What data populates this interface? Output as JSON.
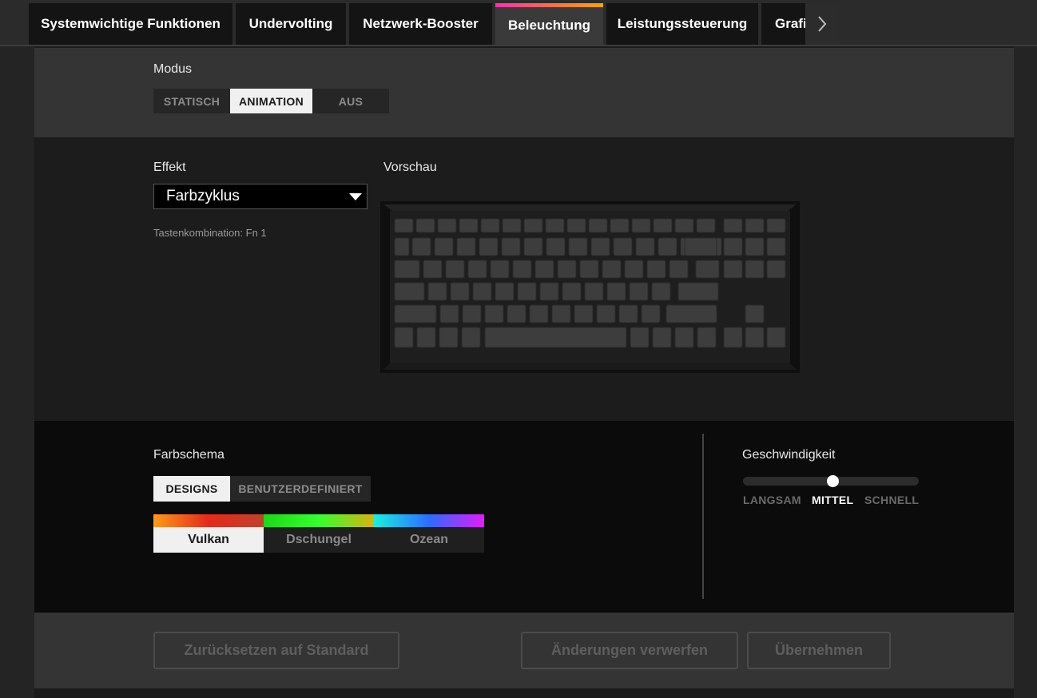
{
  "tabs": [
    {
      "label": "Systemwichtige Funktionen"
    },
    {
      "label": "Undervolting"
    },
    {
      "label": "Netzwerk-Booster"
    },
    {
      "label": "Beleuchtung"
    },
    {
      "label": "Leistungssteuerung"
    },
    {
      "label": "Grafi"
    }
  ],
  "active_tab": "Beleuchtung",
  "mode": {
    "label": "Modus",
    "options": [
      "STATISCH",
      "ANIMATION",
      "AUS"
    ],
    "selected": "ANIMATION"
  },
  "effect": {
    "label": "Effekt",
    "value": "Farbzyklus",
    "hint": "Tastenkombination: Fn 1"
  },
  "preview": {
    "label": "Vorschau"
  },
  "color_scheme": {
    "label": "Farbschema",
    "tabs": [
      "DESIGNS",
      "BENUTZERDEFINIERT"
    ],
    "selected_tab": "DESIGNS",
    "themes": [
      {
        "name": "Vulkan",
        "colors": [
          "#ff9a1a",
          "#e42a1a",
          "#c2402e"
        ]
      },
      {
        "name": "Dschungel",
        "colors": [
          "#1bd816",
          "#35ff2e",
          "#d9b20f"
        ]
      },
      {
        "name": "Ozean",
        "colors": [
          "#19f0e0",
          "#2b6cff",
          "#e31bff"
        ]
      }
    ],
    "selected_theme": "Vulkan"
  },
  "speed": {
    "label": "Geschwindigkeit",
    "options": [
      "LANGSAM",
      "MITTEL",
      "SCHNELL"
    ],
    "selected": "MITTEL",
    "value": 0.5
  },
  "footer": {
    "reset_label": "Zurücksetzen auf Standard",
    "discard_label": "Änderungen verwerfen",
    "apply_label": "Übernehmen"
  }
}
